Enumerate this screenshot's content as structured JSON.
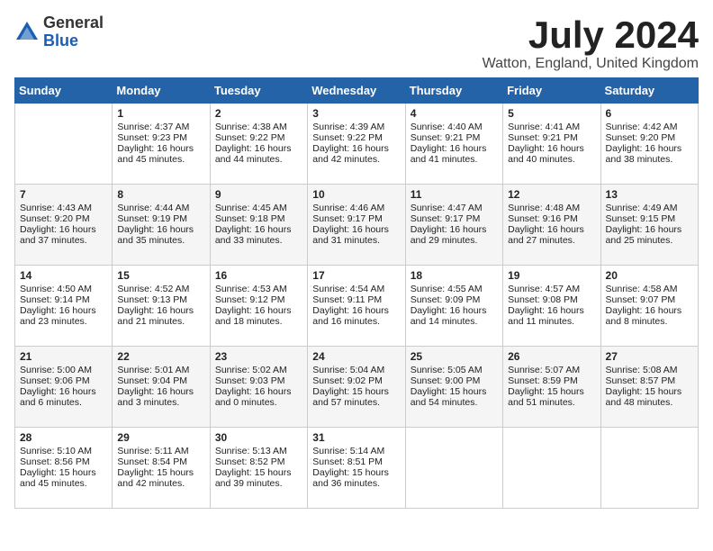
{
  "logo": {
    "general": "General",
    "blue": "Blue"
  },
  "title": "July 2024",
  "location": "Watton, England, United Kingdom",
  "days_of_week": [
    "Sunday",
    "Monday",
    "Tuesday",
    "Wednesday",
    "Thursday",
    "Friday",
    "Saturday"
  ],
  "weeks": [
    [
      {
        "day": "",
        "content": ""
      },
      {
        "day": "1",
        "content": "Sunrise: 4:37 AM\nSunset: 9:23 PM\nDaylight: 16 hours and 45 minutes."
      },
      {
        "day": "2",
        "content": "Sunrise: 4:38 AM\nSunset: 9:22 PM\nDaylight: 16 hours and 44 minutes."
      },
      {
        "day": "3",
        "content": "Sunrise: 4:39 AM\nSunset: 9:22 PM\nDaylight: 16 hours and 42 minutes."
      },
      {
        "day": "4",
        "content": "Sunrise: 4:40 AM\nSunset: 9:21 PM\nDaylight: 16 hours and 41 minutes."
      },
      {
        "day": "5",
        "content": "Sunrise: 4:41 AM\nSunset: 9:21 PM\nDaylight: 16 hours and 40 minutes."
      },
      {
        "day": "6",
        "content": "Sunrise: 4:42 AM\nSunset: 9:20 PM\nDaylight: 16 hours and 38 minutes."
      }
    ],
    [
      {
        "day": "7",
        "content": "Sunrise: 4:43 AM\nSunset: 9:20 PM\nDaylight: 16 hours and 37 minutes."
      },
      {
        "day": "8",
        "content": "Sunrise: 4:44 AM\nSunset: 9:19 PM\nDaylight: 16 hours and 35 minutes."
      },
      {
        "day": "9",
        "content": "Sunrise: 4:45 AM\nSunset: 9:18 PM\nDaylight: 16 hours and 33 minutes."
      },
      {
        "day": "10",
        "content": "Sunrise: 4:46 AM\nSunset: 9:17 PM\nDaylight: 16 hours and 31 minutes."
      },
      {
        "day": "11",
        "content": "Sunrise: 4:47 AM\nSunset: 9:17 PM\nDaylight: 16 hours and 29 minutes."
      },
      {
        "day": "12",
        "content": "Sunrise: 4:48 AM\nSunset: 9:16 PM\nDaylight: 16 hours and 27 minutes."
      },
      {
        "day": "13",
        "content": "Sunrise: 4:49 AM\nSunset: 9:15 PM\nDaylight: 16 hours and 25 minutes."
      }
    ],
    [
      {
        "day": "14",
        "content": "Sunrise: 4:50 AM\nSunset: 9:14 PM\nDaylight: 16 hours and 23 minutes."
      },
      {
        "day": "15",
        "content": "Sunrise: 4:52 AM\nSunset: 9:13 PM\nDaylight: 16 hours and 21 minutes."
      },
      {
        "day": "16",
        "content": "Sunrise: 4:53 AM\nSunset: 9:12 PM\nDaylight: 16 hours and 18 minutes."
      },
      {
        "day": "17",
        "content": "Sunrise: 4:54 AM\nSunset: 9:11 PM\nDaylight: 16 hours and 16 minutes."
      },
      {
        "day": "18",
        "content": "Sunrise: 4:55 AM\nSunset: 9:09 PM\nDaylight: 16 hours and 14 minutes."
      },
      {
        "day": "19",
        "content": "Sunrise: 4:57 AM\nSunset: 9:08 PM\nDaylight: 16 hours and 11 minutes."
      },
      {
        "day": "20",
        "content": "Sunrise: 4:58 AM\nSunset: 9:07 PM\nDaylight: 16 hours and 8 minutes."
      }
    ],
    [
      {
        "day": "21",
        "content": "Sunrise: 5:00 AM\nSunset: 9:06 PM\nDaylight: 16 hours and 6 minutes."
      },
      {
        "day": "22",
        "content": "Sunrise: 5:01 AM\nSunset: 9:04 PM\nDaylight: 16 hours and 3 minutes."
      },
      {
        "day": "23",
        "content": "Sunrise: 5:02 AM\nSunset: 9:03 PM\nDaylight: 16 hours and 0 minutes."
      },
      {
        "day": "24",
        "content": "Sunrise: 5:04 AM\nSunset: 9:02 PM\nDaylight: 15 hours and 57 minutes."
      },
      {
        "day": "25",
        "content": "Sunrise: 5:05 AM\nSunset: 9:00 PM\nDaylight: 15 hours and 54 minutes."
      },
      {
        "day": "26",
        "content": "Sunrise: 5:07 AM\nSunset: 8:59 PM\nDaylight: 15 hours and 51 minutes."
      },
      {
        "day": "27",
        "content": "Sunrise: 5:08 AM\nSunset: 8:57 PM\nDaylight: 15 hours and 48 minutes."
      }
    ],
    [
      {
        "day": "28",
        "content": "Sunrise: 5:10 AM\nSunset: 8:56 PM\nDaylight: 15 hours and 45 minutes."
      },
      {
        "day": "29",
        "content": "Sunrise: 5:11 AM\nSunset: 8:54 PM\nDaylight: 15 hours and 42 minutes."
      },
      {
        "day": "30",
        "content": "Sunrise: 5:13 AM\nSunset: 8:52 PM\nDaylight: 15 hours and 39 minutes."
      },
      {
        "day": "31",
        "content": "Sunrise: 5:14 AM\nSunset: 8:51 PM\nDaylight: 15 hours and 36 minutes."
      },
      {
        "day": "",
        "content": ""
      },
      {
        "day": "",
        "content": ""
      },
      {
        "day": "",
        "content": ""
      }
    ]
  ]
}
